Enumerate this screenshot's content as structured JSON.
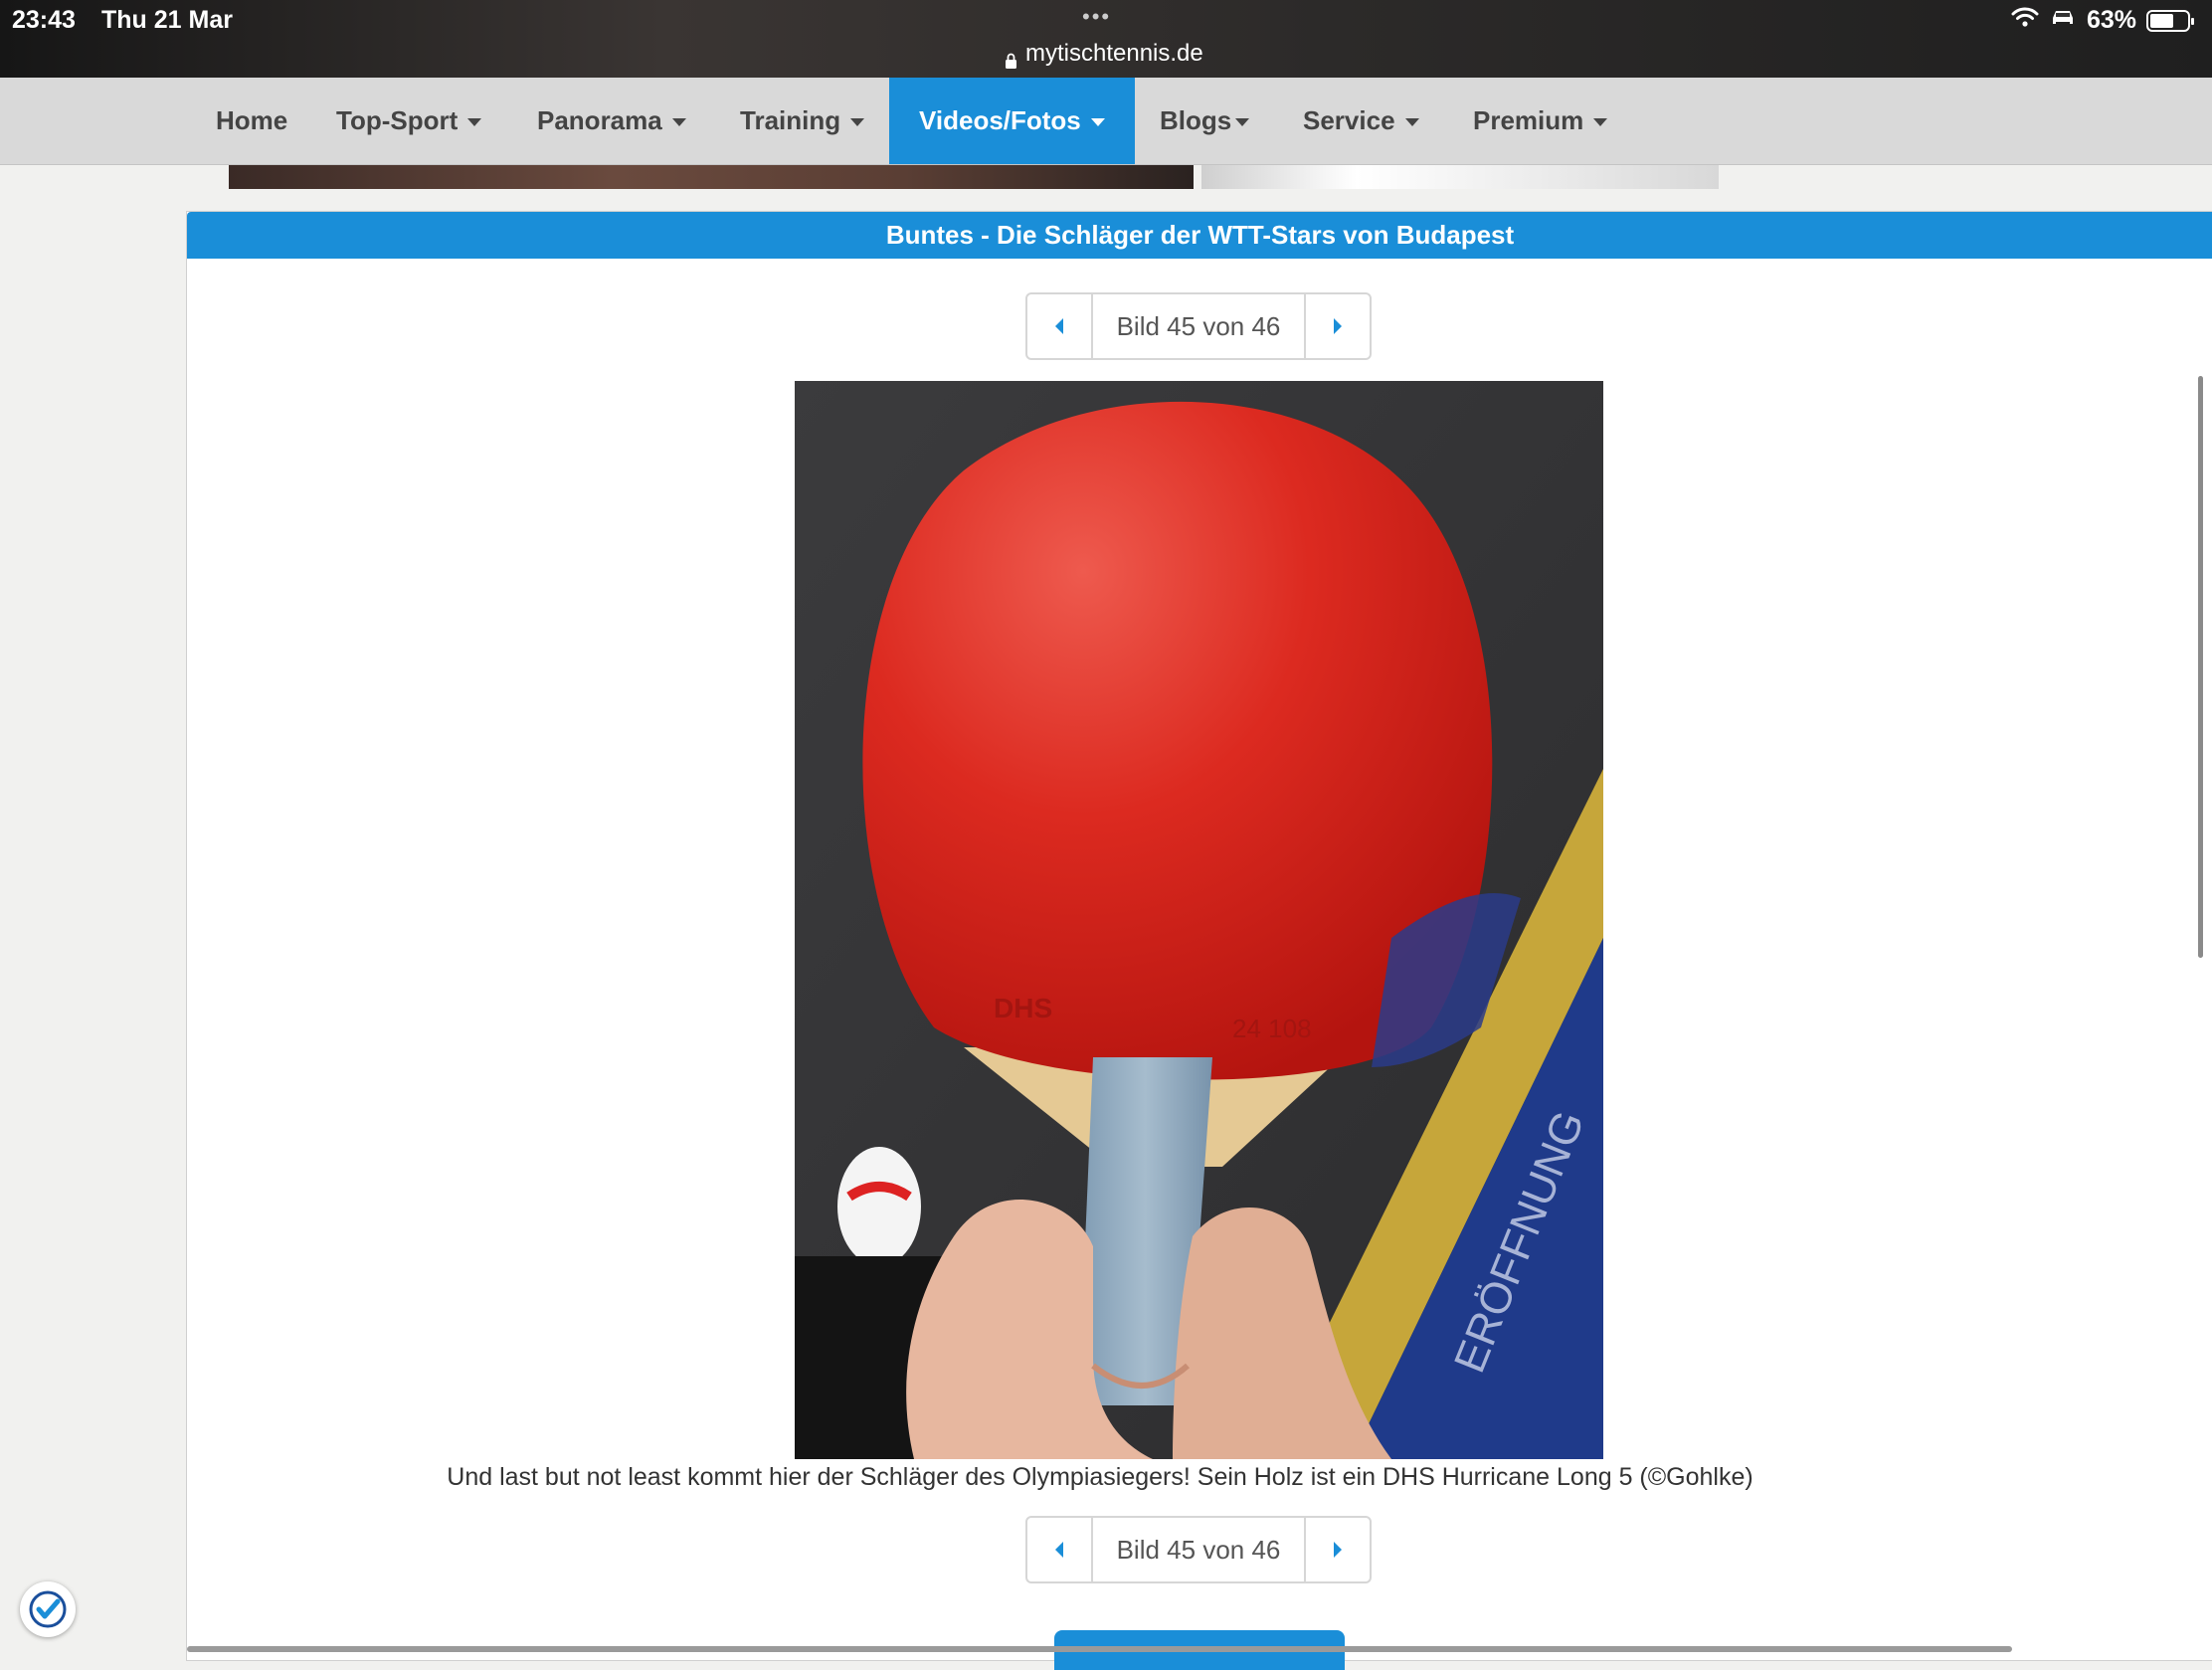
{
  "status_bar": {
    "time": "23:43",
    "date": "Thu 21 Mar",
    "url": "mytischtennis.de",
    "battery_text": "63%",
    "battery_level": 0.63
  },
  "nav": {
    "items": [
      {
        "label": "Home",
        "has_dropdown": false
      },
      {
        "label": "Top-Sport",
        "has_dropdown": true
      },
      {
        "label": "Panorama",
        "has_dropdown": true
      },
      {
        "label": "Training",
        "has_dropdown": true
      },
      {
        "label": "Videos/Fotos",
        "has_dropdown": true,
        "active": true
      },
      {
        "label": "Blogs",
        "has_dropdown": true
      },
      {
        "label": "Service",
        "has_dropdown": true
      },
      {
        "label": "Premium",
        "has_dropdown": true
      }
    ]
  },
  "gallery": {
    "title": "Buntes - Die Schläger der WTT-Stars von Budapest",
    "pager_label": "Bild 45 von 46",
    "current": 45,
    "total": 46,
    "caption": "Und last but not least kommt hier der Schläger des Olympiasiegers! Sein Holz ist ein DHS Hurricane Long 5 (©Gohlke)"
  },
  "colors": {
    "accent": "#1a8ed8",
    "nav_bg": "#d9d9d9",
    "rubber_red": "#d8201a"
  },
  "icons": {
    "prev": "chevron-left-icon",
    "next": "chevron-right-icon",
    "lock": "lock-icon",
    "wifi": "wifi-icon",
    "battery": "battery-icon",
    "badge": "checkmark-badge-icon"
  }
}
